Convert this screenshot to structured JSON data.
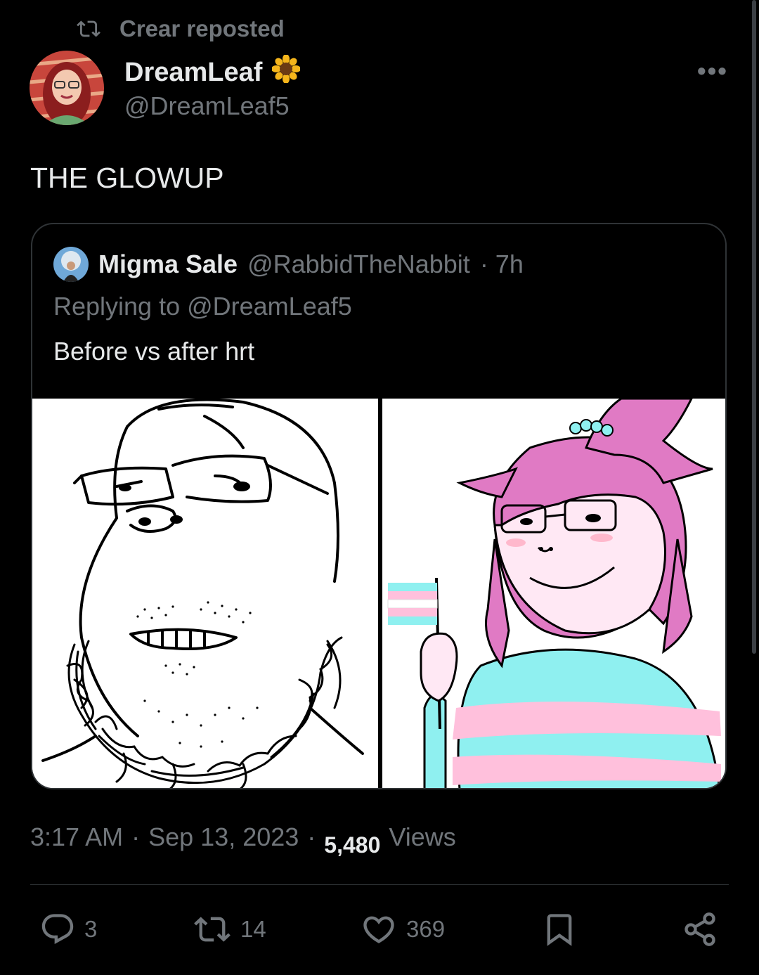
{
  "repost": {
    "label": "Crear reposted"
  },
  "author": {
    "name": "DreamLeaf",
    "handle": "@DreamLeaf5",
    "badge_emoji": "🌻"
  },
  "tweet": {
    "text": "THE GLOWUP"
  },
  "quote": {
    "name": "Migma Sale",
    "handle": "@RabbidTheNabbit",
    "time": "· 7h",
    "reply_to": "Replying to @DreamLeaf5",
    "text": "Before vs after hrt"
  },
  "meta": {
    "time": "3:17 AM",
    "sep1": "·",
    "date": "Sep 13, 2023",
    "sep2": "·",
    "views_count": "5,480",
    "views_label": "Views"
  },
  "actions": {
    "replies": "3",
    "reposts": "14",
    "likes": "369"
  },
  "colors": {
    "background": "#000000",
    "text": "#e7e9ea",
    "muted": "#71767b",
    "border": "#2f3336",
    "pink_hair": "#e07ac4",
    "trans_blue": "#8ff0f0",
    "trans_pink": "#ffc0dc"
  }
}
